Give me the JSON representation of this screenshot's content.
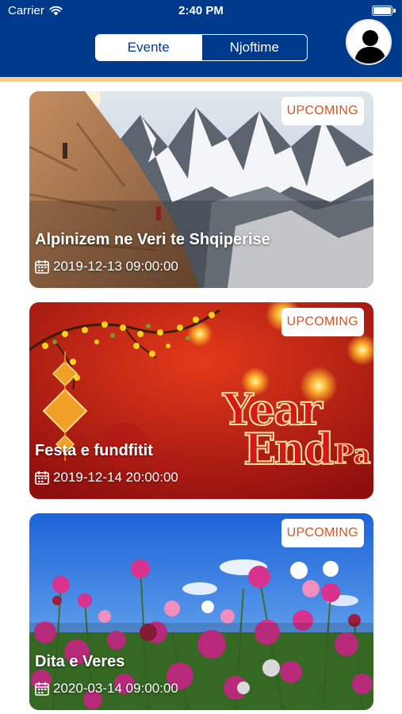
{
  "status_bar": {
    "carrier": "Carrier",
    "time": "2:40 PM"
  },
  "header": {
    "tabs": [
      {
        "label": "Evente",
        "active": true
      },
      {
        "label": "Njoftime",
        "active": false
      }
    ],
    "colors": {
      "bar": "#003a8c",
      "stripe": "#f0cf86",
      "badge_text": "#d9531e"
    }
  },
  "events": [
    {
      "badge": "UPCOMING",
      "title": "Alpinizem ne Veri te Shqiperise",
      "date": "2019-12-13 09:00:00"
    },
    {
      "badge": "UPCOMING",
      "title": "Festa e fundfitit",
      "date": "2019-12-14 20:00:00",
      "image_text": {
        "line1": "Year",
        "line2": "End",
        "line3": "Pa"
      }
    },
    {
      "badge": "UPCOMING",
      "title": "Dita e Veres",
      "date": "2020-03-14 09:00:00"
    }
  ]
}
